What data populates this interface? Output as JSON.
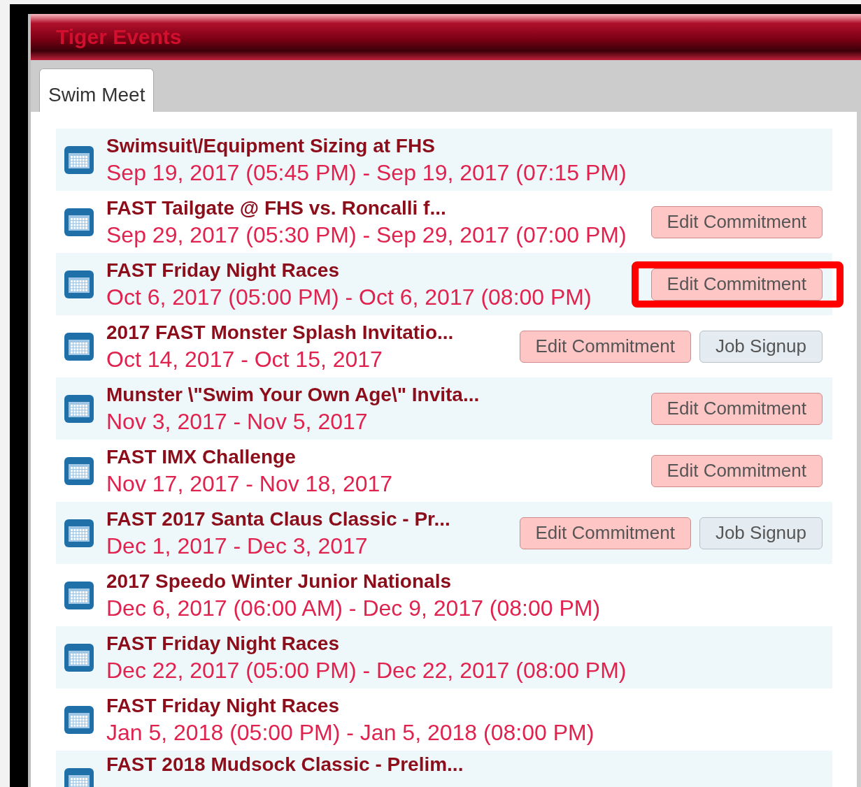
{
  "header": {
    "title": "Tiger Events"
  },
  "tabs": [
    {
      "label": "Swim Meet",
      "selected": true
    }
  ],
  "events": [
    {
      "title": "Swimsuit\\/Equipment Sizing at FHS",
      "dates": "Sep 19, 2017 (05:45 PM) - Sep 19, 2017 (07:15 PM)"
    },
    {
      "title": "FAST Tailgate @ FHS vs. Roncalli f...",
      "dates": "Sep 29, 2017 (05:30 PM) - Sep 29, 2017 (07:00 PM)",
      "buttons": [
        {
          "label": "Edit Commitment",
          "kind": "commitment",
          "highlighted": false
        }
      ]
    },
    {
      "title": "FAST Friday Night Races",
      "dates": "Oct 6, 2017 (05:00 PM) - Oct 6, 2017 (08:00 PM)",
      "buttons": [
        {
          "label": "Edit Commitment",
          "kind": "commitment",
          "highlighted": true
        }
      ]
    },
    {
      "title": "2017 FAST Monster Splash Invitatio...",
      "dates": "Oct 14, 2017 - Oct 15, 2017",
      "buttons": [
        {
          "label": "Edit Commitment",
          "kind": "commitment",
          "highlighted": false
        },
        {
          "label": "Job Signup",
          "kind": "job",
          "highlighted": false
        }
      ]
    },
    {
      "title": "Munster \\\"Swim Your Own Age\\\" Invita...",
      "dates": "Nov 3, 2017 - Nov 5, 2017",
      "buttons": [
        {
          "label": "Edit Commitment",
          "kind": "commitment",
          "highlighted": false
        }
      ]
    },
    {
      "title": "FAST IMX Challenge",
      "dates": "Nov 17, 2017 - Nov 18, 2017",
      "buttons": [
        {
          "label": "Edit Commitment",
          "kind": "commitment",
          "highlighted": false
        }
      ]
    },
    {
      "title": "FAST 2017 Santa Claus Classic - Pr...",
      "dates": "Dec 1, 2017 - Dec 3, 2017",
      "buttons": [
        {
          "label": "Edit Commitment",
          "kind": "commitment",
          "highlighted": false
        },
        {
          "label": "Job Signup",
          "kind": "job",
          "highlighted": false
        }
      ]
    },
    {
      "title": "2017 Speedo Winter Junior Nationals",
      "dates": "Dec 6, 2017 (06:00 AM) - Dec 9, 2017 (08:00 PM)"
    },
    {
      "title": "FAST Friday Night Races",
      "dates": "Dec 22, 2017 (05:00 PM) - Dec 22, 2017 (08:00 PM)"
    },
    {
      "title": "FAST Friday Night Races",
      "dates": "Jan 5, 2018 (05:00 PM) - Jan 5, 2018 (08:00 PM)"
    },
    {
      "title": "FAST 2018 Mudsock Classic - Prelim..."
    }
  ]
}
